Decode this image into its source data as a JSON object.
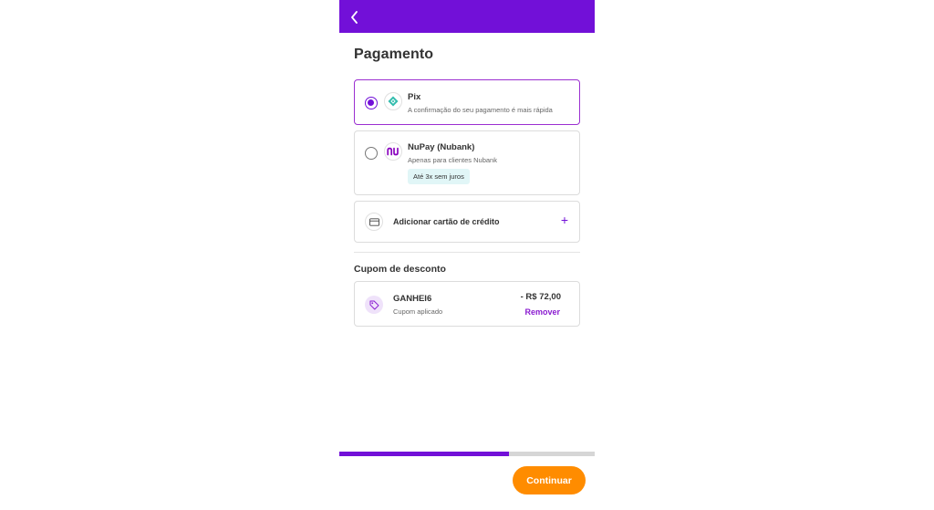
{
  "header": {
    "back_icon": "chevron-left-icon",
    "color": "#7210d8"
  },
  "page": {
    "title": "Pagamento"
  },
  "payment_options": [
    {
      "title": "Pix",
      "subtitle": "A confirmação do seu pagamento é mais rápida",
      "selected": true,
      "icon": "pix-icon"
    },
    {
      "title": "NuPay (Nubank)",
      "subtitle": "Apenas para clientes Nubank",
      "badge": "Até 3x sem juros",
      "selected": false,
      "icon": "nubank-logo"
    }
  ],
  "add_card": {
    "label": "Adicionar cartão de crédito",
    "icon": "credit-card-icon",
    "action_icon": "plus-icon"
  },
  "coupon": {
    "section_title": "Cupom de desconto",
    "code": "GANHEI6",
    "status": "Cupom aplicado",
    "amount": "- R$ 72,00",
    "remove_label": "Remover",
    "icon": "tag-icon"
  },
  "progress": {
    "fraction": 0.666
  },
  "footer": {
    "continue_label": "Continuar",
    "button_color": "#ff8c00"
  }
}
